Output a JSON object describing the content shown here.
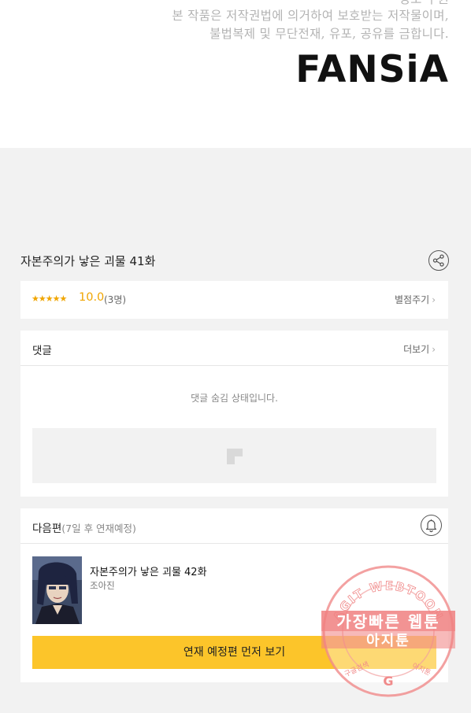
{
  "top": {
    "notice_lines": [
      "정보 구권",
      "본 작품은 저작권법에 의거하여 보호받는 저작물이며,",
      "불법복제 및 무단전재, 유포, 공유를 금합니다."
    ],
    "logo": "FANSiA"
  },
  "episode": {
    "title": "자본주의가 낳은 괴물 41화"
  },
  "rating": {
    "stars": "★★★★★",
    "score": "10.0",
    "count": "(3명)",
    "rate_link": "별점주기"
  },
  "comments": {
    "title": "댓글",
    "more": "더보기",
    "hidden_message": "댓글 숨김 상태입니다."
  },
  "next": {
    "title": "다음편",
    "subtitle": "(7일 후 연재예정)",
    "episode_title": "자본주의가 낳은 괴물 42화",
    "author": "조아진",
    "cta": "연재 예정편 먼저 보기"
  },
  "watermark": {
    "arc_text": "AGIT WEBTOON",
    "line1": "가장빠른 웹툰",
    "line2": "아지툰",
    "bottom_left": "구글검색",
    "bottom_right": "아지툰",
    "g_letter": "G"
  },
  "colors": {
    "accent_orange": "#f0a500",
    "cta_yellow": "#fcc52a",
    "page_bg": "#f2f2f2",
    "watermark_red": "#e57373"
  },
  "icons": {
    "share": "share-icon",
    "bell": "bell-icon",
    "chevron": "chevron-right-icon"
  }
}
